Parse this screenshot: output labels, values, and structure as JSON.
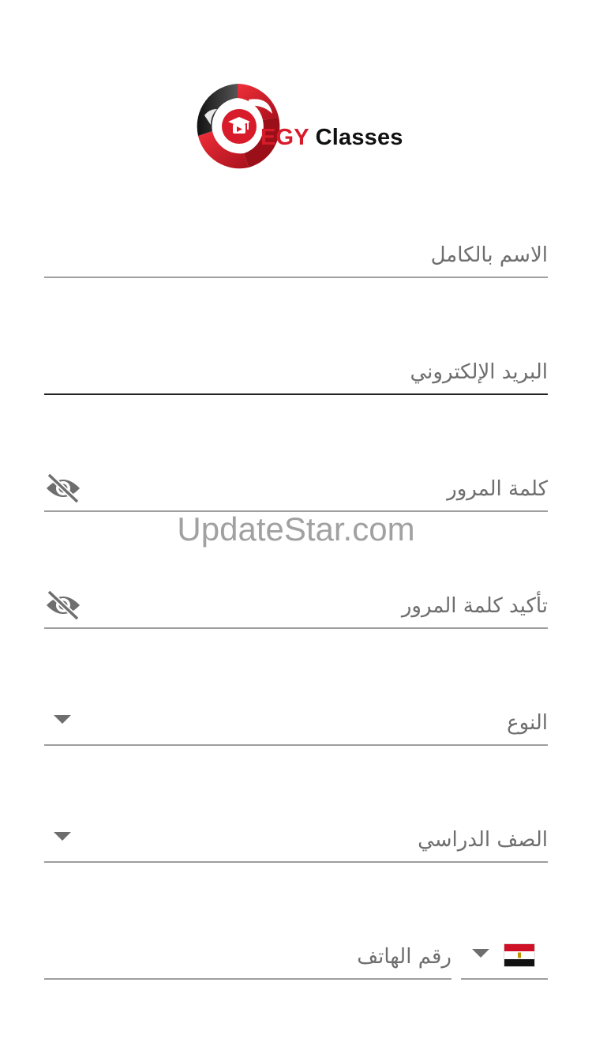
{
  "brand": {
    "logo_part1": "EGY",
    "logo_part2": "Classes",
    "colors": {
      "red": "#d81b2a",
      "dark": "#111111"
    }
  },
  "form": {
    "full_name": {
      "label": "الاسم بالكامل"
    },
    "email": {
      "label": "البريد الإلكتروني"
    },
    "password": {
      "label": "كلمة المرور",
      "icon": "eye-off-icon"
    },
    "confirm_password": {
      "label": "تأكيد كلمة المرور",
      "icon": "eye-off-icon"
    },
    "gender": {
      "label": "النوع",
      "icon": "dropdown-arrow-icon"
    },
    "grade": {
      "label": "الصف الدراسي",
      "icon": "dropdown-arrow-icon"
    },
    "phone": {
      "label": "رقم الهاتف",
      "country_flag": "egypt-flag-icon",
      "icon": "dropdown-arrow-icon"
    }
  },
  "watermark": {
    "text": "UpdateStar.com"
  }
}
